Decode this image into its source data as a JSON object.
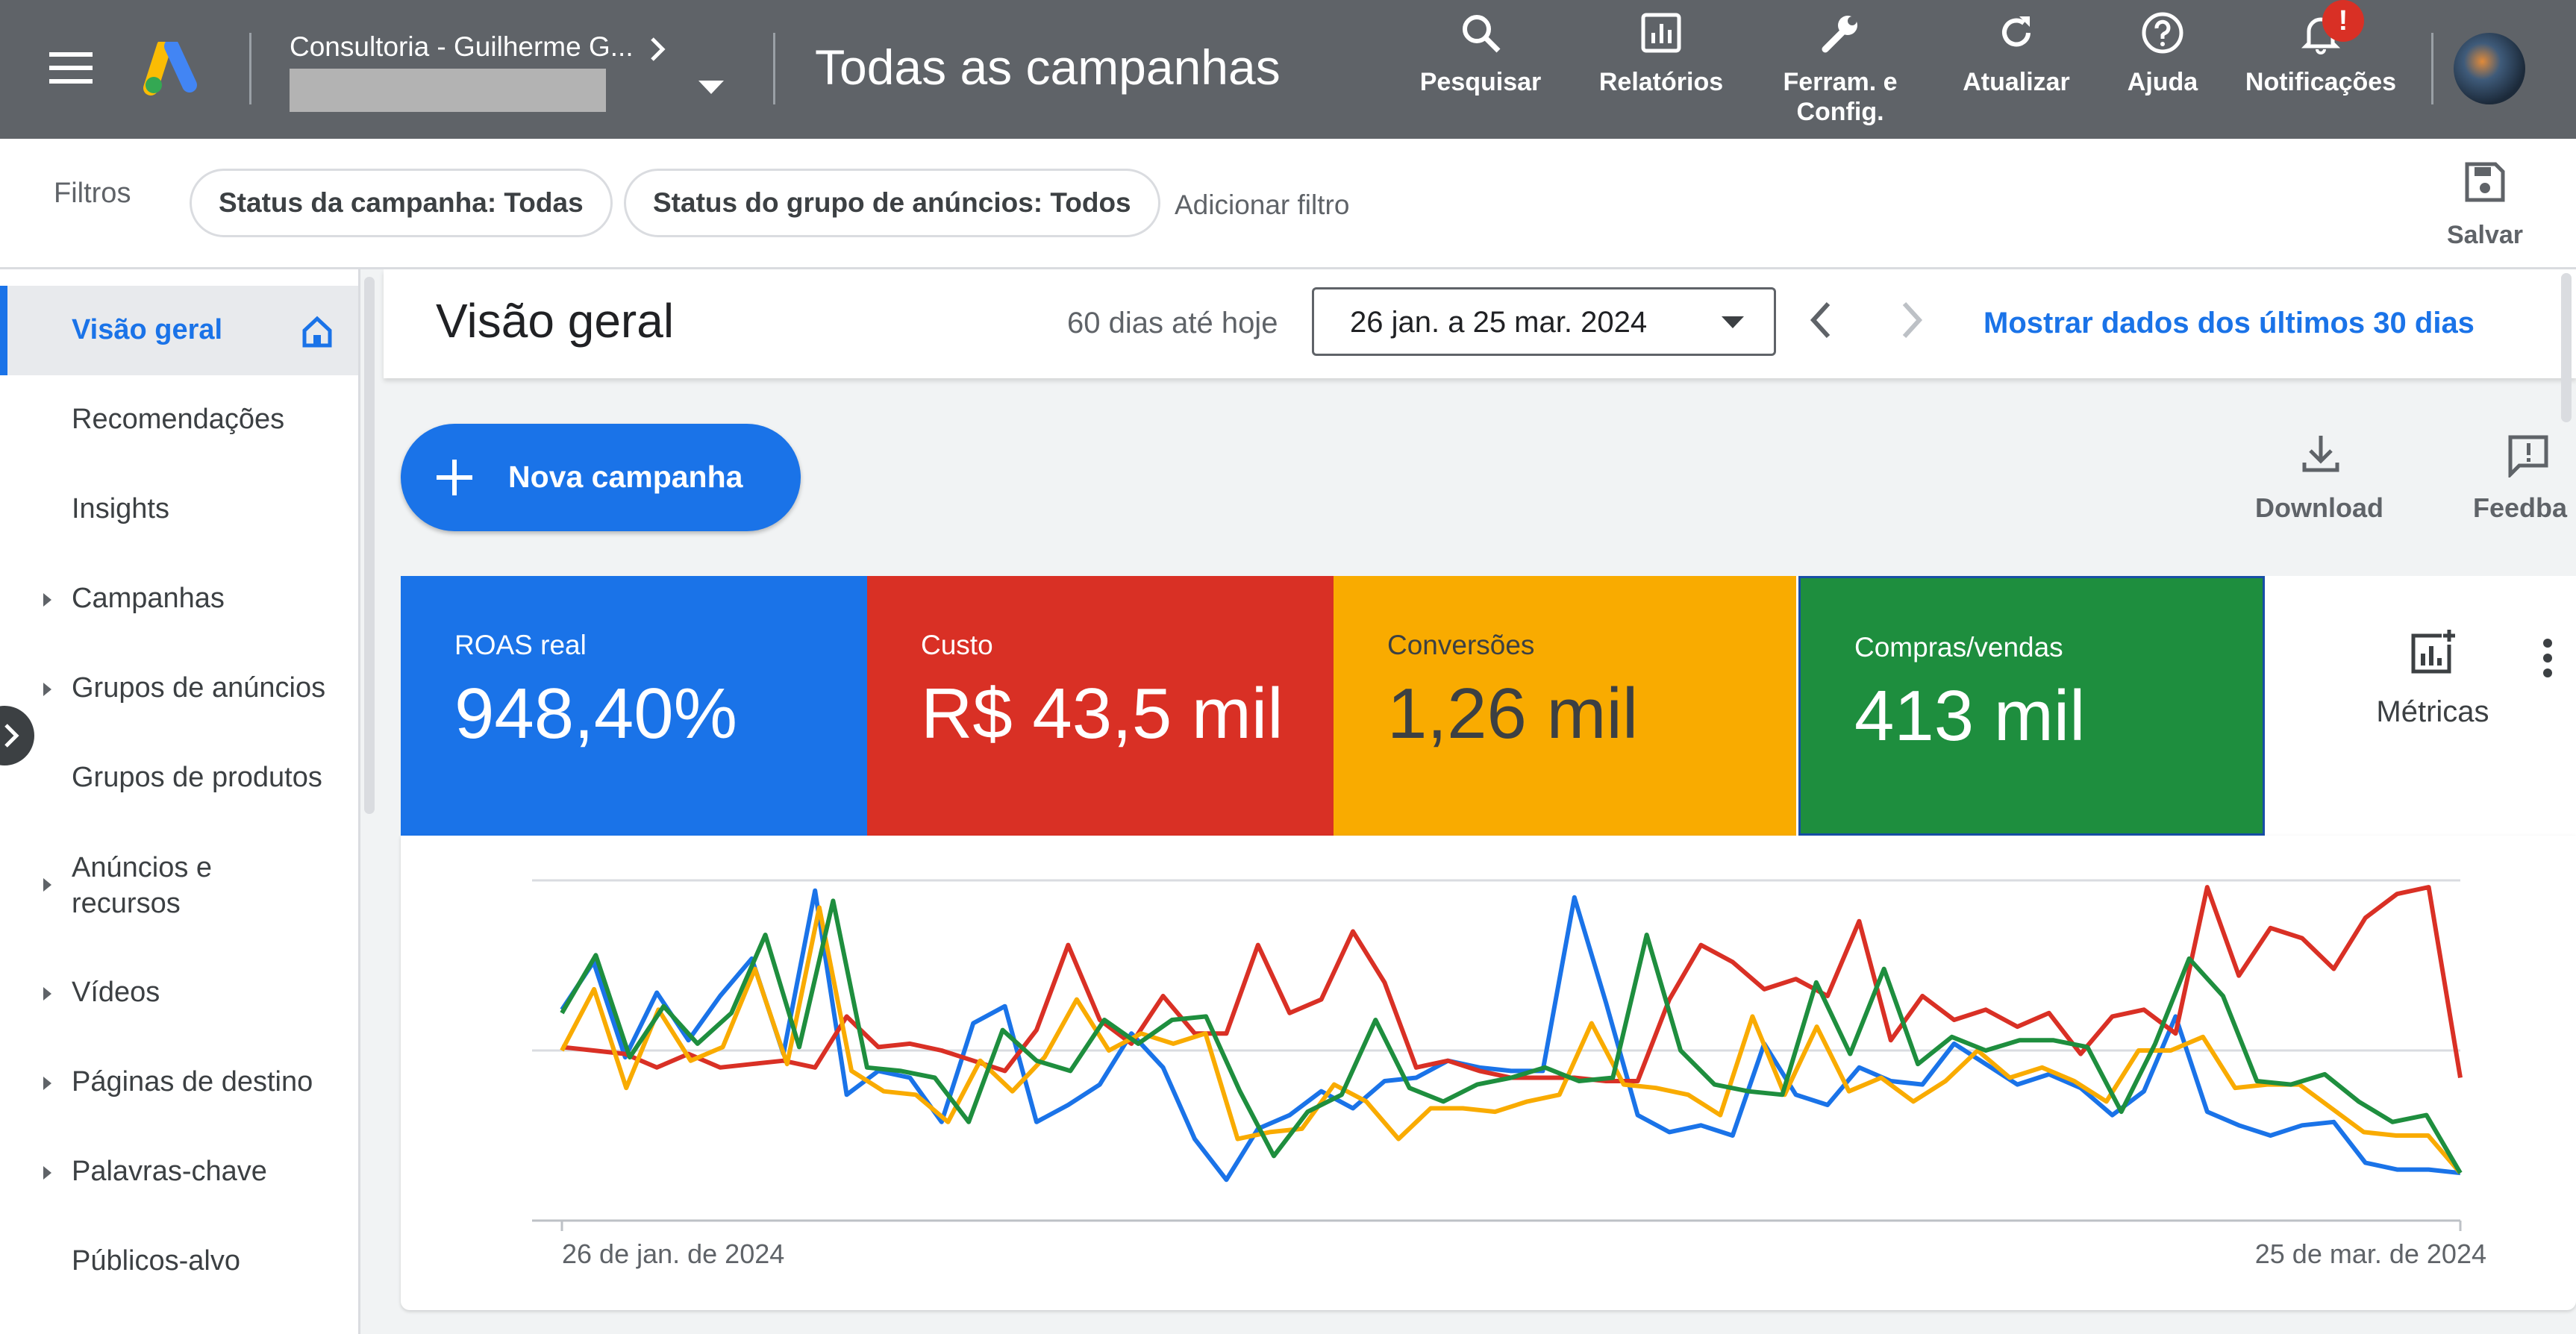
{
  "header": {
    "account_name": "Consultoria - Guilherme G...",
    "page_title": "Todas as campanhas",
    "notification_badge": "!",
    "actions": [
      {
        "label": "Pesquisar",
        "icon": "search-icon"
      },
      {
        "label": "Relatórios",
        "icon": "reports-icon"
      },
      {
        "label": "Ferram. e Config.",
        "icon": "wrench-icon"
      },
      {
        "label": "Atualizar",
        "icon": "refresh-icon"
      },
      {
        "label": "Ajuda",
        "icon": "help-icon"
      },
      {
        "label": "Notificações",
        "icon": "bell-icon"
      }
    ]
  },
  "filters": {
    "label": "Filtros",
    "chips": [
      "Status da campanha: Todas",
      "Status do grupo de anúncios: Todos"
    ],
    "add_filter": "Adicionar filtro",
    "save_label": "Salvar"
  },
  "sidebar": {
    "items": [
      {
        "label": "Visão geral",
        "active": true,
        "expandable": false
      },
      {
        "label": "Recomendações",
        "expandable": false
      },
      {
        "label": "Insights",
        "expandable": false
      },
      {
        "label": "Campanhas",
        "expandable": true
      },
      {
        "label": "Grupos de anúncios",
        "expandable": true
      },
      {
        "label": "Grupos de produtos",
        "expandable": false
      },
      {
        "label": "Anúncios e recursos",
        "expandable": true
      },
      {
        "label": "Vídeos",
        "expandable": true
      },
      {
        "label": "Páginas de destino",
        "expandable": true
      },
      {
        "label": "Palavras-chave",
        "expandable": true
      },
      {
        "label": "Públicos-alvo",
        "expandable": false
      }
    ]
  },
  "overview": {
    "title": "Visão geral",
    "range_caption": "60 dias até hoje",
    "date_range": "26 jan. a 25 mar. 2024",
    "show_last_30": "Mostrar dados dos últimos 30 dias",
    "new_campaign": "Nova campanha",
    "download": "Download",
    "feedback": "Feedba",
    "metrics_button": "Métricas"
  },
  "metric_cards": [
    {
      "label": "ROAS real",
      "value": "948,40%",
      "color": "#1a73e8"
    },
    {
      "label": "Custo",
      "value": "R$ 43,5 mil",
      "color": "#d93025"
    },
    {
      "label": "Conversões",
      "value": "1,26 mil",
      "color": "#f9ab00"
    },
    {
      "label": "Compras/vendas",
      "value": "413 mil",
      "color": "#1e8e3e"
    }
  ],
  "chart_data": {
    "type": "line",
    "x_start_label": "26 de jan. de 2024",
    "x_end_label": "25 de mar. de 2024",
    "x_count": 60,
    "y_range": [
      0,
      1
    ],
    "grid": true,
    "series": [
      {
        "color": "#1a73e8",
        "values": [
          0.62,
          0.76,
          0.48,
          0.67,
          0.53,
          0.66,
          0.77,
          0.49,
          0.97,
          0.37,
          0.44,
          0.42,
          0.29,
          0.58,
          0.63,
          0.29,
          0.34,
          0.4,
          0.55,
          0.45,
          0.24,
          0.12,
          0.27,
          0.31,
          0.38,
          0.33,
          0.41,
          0.42,
          0.47,
          0.45,
          0.44,
          0.44,
          0.95,
          0.64,
          0.31,
          0.26,
          0.28,
          0.25,
          0.52,
          0.37,
          0.34,
          0.45,
          0.41,
          0.4,
          0.52,
          0.46,
          0.4,
          0.43,
          0.39,
          0.31,
          0.38,
          0.6,
          0.32,
          0.28,
          0.25,
          0.28,
          0.29,
          0.17,
          0.15,
          0.15,
          0.14
        ]
      },
      {
        "color": "#d93025",
        "values": [
          0.51,
          0.5,
          0.49,
          0.45,
          0.49,
          0.45,
          0.46,
          0.47,
          0.45,
          0.6,
          0.51,
          0.52,
          0.5,
          0.47,
          0.44,
          0.56,
          0.81,
          0.59,
          0.52,
          0.66,
          0.55,
          0.55,
          0.81,
          0.61,
          0.65,
          0.85,
          0.7,
          0.45,
          0.47,
          0.44,
          0.42,
          0.42,
          0.42,
          0.41,
          0.41,
          0.65,
          0.81,
          0.76,
          0.68,
          0.71,
          0.66,
          0.88,
          0.53,
          0.66,
          0.59,
          0.62,
          0.57,
          0.61,
          0.49,
          0.6,
          0.62,
          0.55,
          0.98,
          0.72,
          0.86,
          0.83,
          0.74,
          0.89,
          0.96,
          0.98,
          0.42
        ]
      },
      {
        "color": "#f9ab00",
        "values": [
          0.5,
          0.68,
          0.39,
          0.62,
          0.47,
          0.51,
          0.74,
          0.46,
          0.92,
          0.44,
          0.38,
          0.37,
          0.29,
          0.47,
          0.38,
          0.48,
          0.65,
          0.5,
          0.55,
          0.52,
          0.55,
          0.24,
          0.26,
          0.27,
          0.4,
          0.35,
          0.24,
          0.33,
          0.33,
          0.32,
          0.35,
          0.37,
          0.58,
          0.4,
          0.39,
          0.37,
          0.31,
          0.6,
          0.37,
          0.57,
          0.38,
          0.42,
          0.35,
          0.41,
          0.5,
          0.42,
          0.45,
          0.41,
          0.35,
          0.5,
          0.5,
          0.54,
          0.39,
          0.4,
          0.4,
          0.33,
          0.26,
          0.25,
          0.25,
          0.14
        ]
      },
      {
        "color": "#1e8e3e",
        "values": [
          0.61,
          0.78,
          0.48,
          0.63,
          0.52,
          0.61,
          0.84,
          0.51,
          0.94,
          0.45,
          0.44,
          0.42,
          0.29,
          0.56,
          0.47,
          0.44,
          0.59,
          0.52,
          0.59,
          0.6,
          0.38,
          0.19,
          0.32,
          0.37,
          0.59,
          0.39,
          0.35,
          0.4,
          0.42,
          0.45,
          0.41,
          0.42,
          0.84,
          0.5,
          0.4,
          0.38,
          0.37,
          0.7,
          0.49,
          0.74,
          0.46,
          0.54,
          0.5,
          0.53,
          0.53,
          0.51,
          0.32,
          0.52,
          0.77,
          0.66,
          0.41,
          0.4,
          0.43,
          0.35,
          0.29,
          0.31,
          0.14
        ]
      }
    ]
  }
}
